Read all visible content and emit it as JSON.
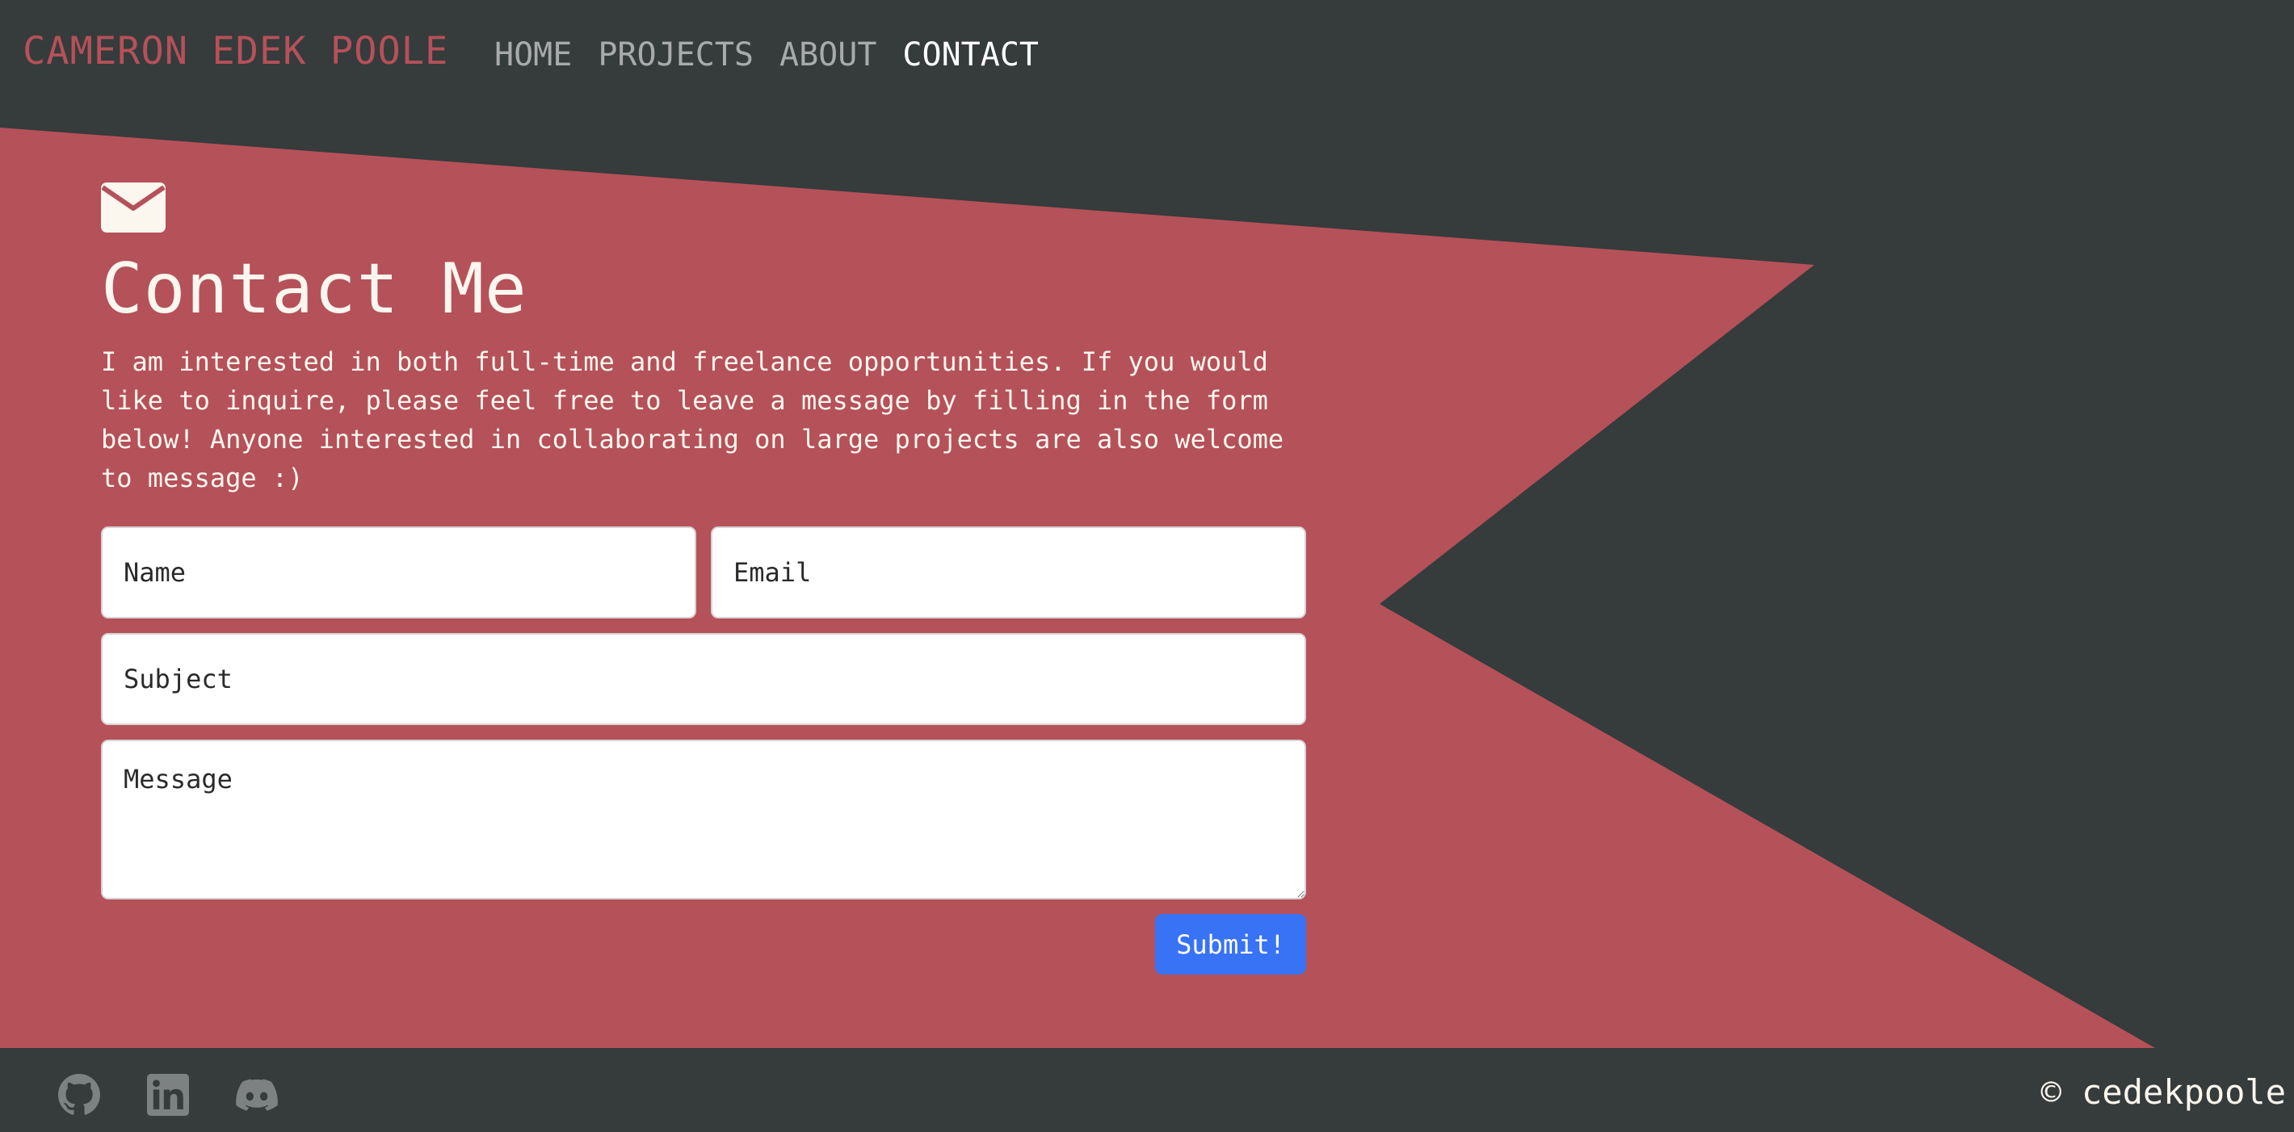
{
  "navbar": {
    "brand": "CAMERON EDEK POOLE",
    "links": [
      "HOME",
      "PROJECTS",
      "ABOUT",
      "CONTACT"
    ],
    "active": "CONTACT"
  },
  "contact": {
    "icon": "envelope-icon",
    "title": "Contact Me",
    "intro": "I am interested in both full-time and freelance opportunities. If you would like to inquire, please feel free to leave a message by filling in the form below! Anyone interested in collaborating on large projects are also welcome to message :)"
  },
  "form": {
    "name_placeholder": "Name",
    "email_placeholder": "Email",
    "subject_placeholder": "Subject",
    "message_placeholder": "Message",
    "submit_label": "Submit!"
  },
  "footer": {
    "social_icons": [
      "github-icon",
      "linkedin-icon",
      "discord-icon"
    ],
    "copyright": "© cedekpoole"
  },
  "colors": {
    "background": "#363b3c",
    "accent": "#b55159",
    "text_light": "#fbf6ee",
    "nav_inactive": "#a9abab",
    "button": "#3873f6"
  }
}
